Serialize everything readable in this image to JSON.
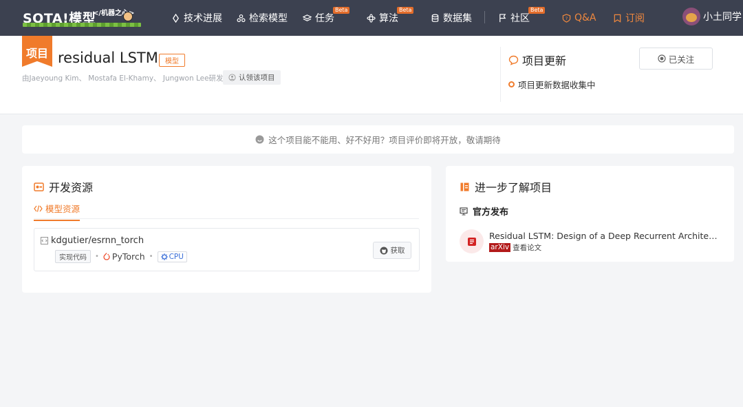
{
  "nav": {
    "logo_text": "SOTA!模型",
    "logo_sub": "</机器之心>",
    "items": [
      {
        "label": "技术进展",
        "icon": "rocket-icon"
      },
      {
        "label": "检索模型",
        "icon": "nodes-icon"
      },
      {
        "label": "任务",
        "icon": "layers-icon",
        "badge": "Beta"
      },
      {
        "label": "算法",
        "icon": "atom-icon",
        "badge": "Beta"
      },
      {
        "label": "数据集",
        "icon": "database-icon"
      },
      {
        "label": "社区",
        "icon": "flag-icon",
        "badge": "Beta"
      },
      {
        "label": "Q&A",
        "icon": "question-icon"
      },
      {
        "label": "订阅",
        "icon": "bookmark-icon"
      }
    ],
    "user_name": "小土同学"
  },
  "project": {
    "ribbon": "项目",
    "title": "residual LSTM",
    "type_tag": "模型",
    "authors": "由Jaeyoung Kim、 Mostafa El-Khamy、 Jungwon Lee研发",
    "claim_label": "认领该项目",
    "updates_title": "项目更新",
    "follow_label": "已关注",
    "update_status": "项目更新数据收集中"
  },
  "notice": "这个项目能不能用、好不好用？项目评价即将开放，敬请期待",
  "dev": {
    "title": "开发资源",
    "tab": "模型资源",
    "repo": {
      "name": "kdgutier/esrnn_torch",
      "code_tag": "实现代码",
      "framework": "PyTorch",
      "device": "CPU",
      "get_label": "获取"
    }
  },
  "learn": {
    "title": "进一步了解项目",
    "section": "官方发布",
    "paper_title": "Residual LSTM: Design of a Deep Recurrent Architecture...",
    "source": "arXiv",
    "view_label": "查看论文"
  },
  "colors": {
    "accent": "#f07b2b",
    "nav_bg": "#3c4150",
    "arxiv_red": "#b31b1b"
  }
}
